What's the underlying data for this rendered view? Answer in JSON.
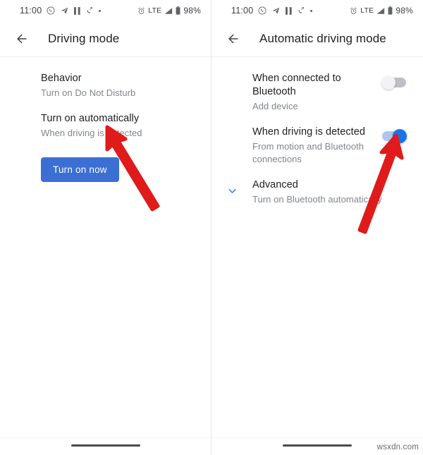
{
  "watermark": "wsxdn.com",
  "status_bar": {
    "time": "11:00",
    "lte_label": "LTE",
    "battery_percent": "98%",
    "left_icons": [
      "whatsapp-icon",
      "telegram-icon",
      "pause-icon",
      "missed-call-icon",
      "more-dot-icon"
    ],
    "right_icons": [
      "alarm-icon",
      "signal-icon",
      "battery-icon"
    ]
  },
  "colors": {
    "accent_blue": "#1a73e8",
    "button_blue": "#3b6fd4",
    "toggle_on_track": "#aec5f0",
    "toggle_off_track": "#bdc1c6",
    "title_text": "#202124",
    "subtitle_text": "#80868b",
    "arrow_red": "#e01b1b"
  },
  "left_screen": {
    "back_label": "Back",
    "title": "Driving mode",
    "items": [
      {
        "title": "Behavior",
        "subtitle": "Turn on Do Not Disturb",
        "control": "none"
      },
      {
        "title": "Turn on automatically",
        "subtitle": "When driving is detected",
        "control": "none"
      }
    ],
    "button": {
      "label": "Turn on now"
    }
  },
  "right_screen": {
    "back_label": "Back",
    "title": "Automatic driving mode",
    "items": [
      {
        "title": "When connected to Bluetooth",
        "subtitle": "Add device",
        "control": "toggle",
        "toggle_state": "off"
      },
      {
        "title": "When driving is detected",
        "subtitle": "From motion and Bluetooth connections",
        "control": "toggle",
        "toggle_state": "on"
      },
      {
        "title": "Advanced",
        "subtitle": "Turn on Bluetooth automatically",
        "control": "expand",
        "expand_icon": "chevron-down-icon"
      }
    ]
  },
  "annotations": [
    {
      "name": "arrow-to-turn-on-now",
      "color": "#e01b1b"
    },
    {
      "name": "arrow-to-driving-toggle",
      "color": "#e01b1b"
    }
  ]
}
